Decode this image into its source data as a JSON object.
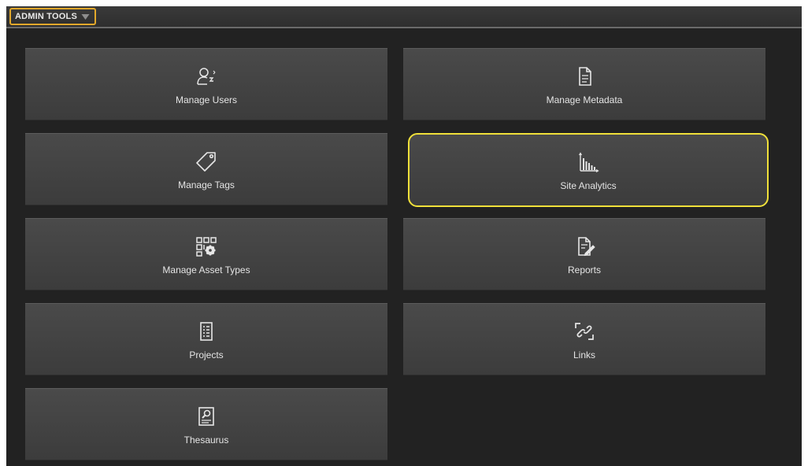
{
  "header": {
    "menu_label": "ADMIN TOOLS",
    "menu_icon": "chevron-down-icon",
    "highlight_color": "#e2a82b"
  },
  "tiles": [
    {
      "label": "Manage Users",
      "icon": "users-icon"
    },
    {
      "label": "Manage Metadata",
      "icon": "document-icon"
    },
    {
      "label": "Manage Tags",
      "icon": "tag-icon"
    },
    {
      "label": "Site Analytics",
      "icon": "analytics-chart-icon",
      "highlighted": true
    },
    {
      "label": "Manage Asset Types",
      "icon": "asset-types-icon"
    },
    {
      "label": "Reports",
      "icon": "report-icon"
    },
    {
      "label": "Projects",
      "icon": "projects-list-icon"
    },
    {
      "label": "Links",
      "icon": "link-icon"
    },
    {
      "label": "Thesaurus",
      "icon": "thesaurus-icon"
    }
  ],
  "colors": {
    "background": "#222222",
    "tile": "#444444",
    "tile_highlight_border": "#f0e03a",
    "text": "#e4e4e4"
  }
}
